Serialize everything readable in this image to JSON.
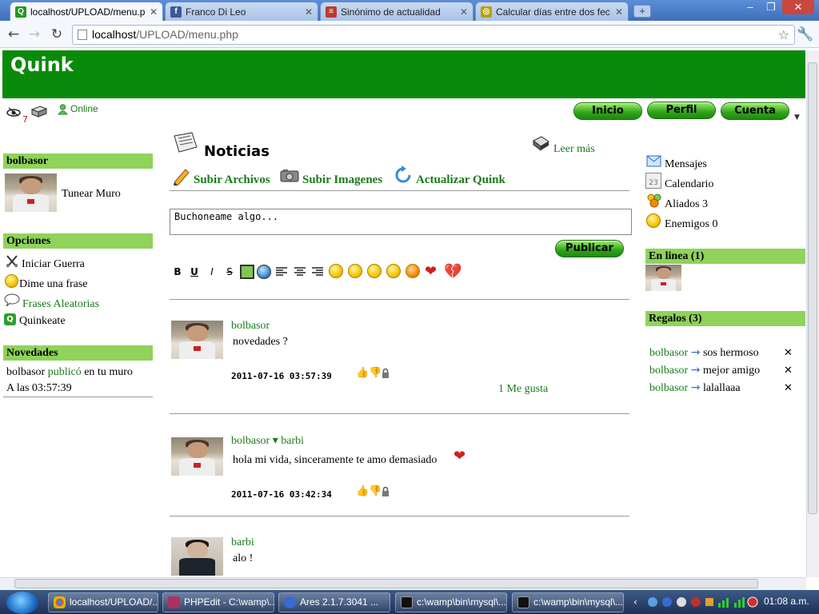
{
  "browser": {
    "tabs": [
      {
        "title": "localhost/UPLOAD/menu.php",
        "active": true
      },
      {
        "title": "Franco Di Leo"
      },
      {
        "title": "Sinónimo de actualidad"
      },
      {
        "title": "Calcular días entre dos fechas"
      }
    ],
    "new_tab": "+",
    "url_host": "localhost",
    "url_path": "/UPLOAD/menu.php"
  },
  "header": {
    "logo": "Quink"
  },
  "status": {
    "notif_count": "7",
    "online_label": "Online"
  },
  "nav": {
    "inicio": "Inicio",
    "perfil": "Perfil",
    "cuenta": "Cuenta"
  },
  "left": {
    "user_header": "bolbasor",
    "tunear": "Tunear Muro",
    "opciones_header": "Opciones",
    "options": [
      "Iniciar Guerra",
      "Dime una frase",
      "Frases Aleatorias",
      "Quinkeate"
    ],
    "novedades_header": "Novedades",
    "nov_user": "bolbasor",
    "nov_action": "publicó",
    "nov_rest": "en tu muro",
    "nov_time": "A las 03:57:39"
  },
  "center": {
    "title": "Noticias",
    "leer_mas": "Leer más",
    "actions": [
      "Subir Archivos",
      "Subir Imagenes",
      "Actualizar Quink"
    ],
    "textarea_value": "Buchoneame algo...",
    "publicar": "Publicar",
    "format": {
      "bold": "B",
      "underline": "U",
      "italic": "I",
      "strike": "S"
    },
    "posts": [
      {
        "user": "bolbasor",
        "text": "novedades ?",
        "date": "2011-07-16 03:57:39",
        "likes": "1 Me gusta"
      },
      {
        "user": "bolbasor",
        "arrow": "▾",
        "target": "barbi",
        "text": "hola mi vida, sinceramente te amo demasiado",
        "date": "2011-07-16 03:42:34"
      },
      {
        "user": "barbi",
        "text": "alo !"
      }
    ]
  },
  "right": {
    "menu": [
      "Mensajes",
      "Calendario",
      "Aliados 3",
      "Enemigos 0"
    ],
    "calendar_day": "23",
    "online_header": "En linea (1)",
    "regalos_header": "Regalos (3)",
    "gifts": [
      {
        "from": "bolbasor",
        "text": "sos hermoso"
      },
      {
        "from": "bolbasor",
        "text": "mejor amigo"
      },
      {
        "from": "bolbasor",
        "text": "lalallaaa"
      }
    ]
  },
  "taskbar": {
    "items": [
      "localhost/UPLOAD/...",
      "PHPEdit - C:\\wamp\\...",
      "Ares 2.1.7.3041 ...",
      "c:\\wamp\\bin\\mysql\\...",
      "c:\\wamp\\bin\\mysql\\..."
    ],
    "clock": "01:08 a.m."
  },
  "colors": {
    "brand_green": "#0a8a0a",
    "section_green": "#8fd35a",
    "link_green": "#1a7a1a"
  }
}
